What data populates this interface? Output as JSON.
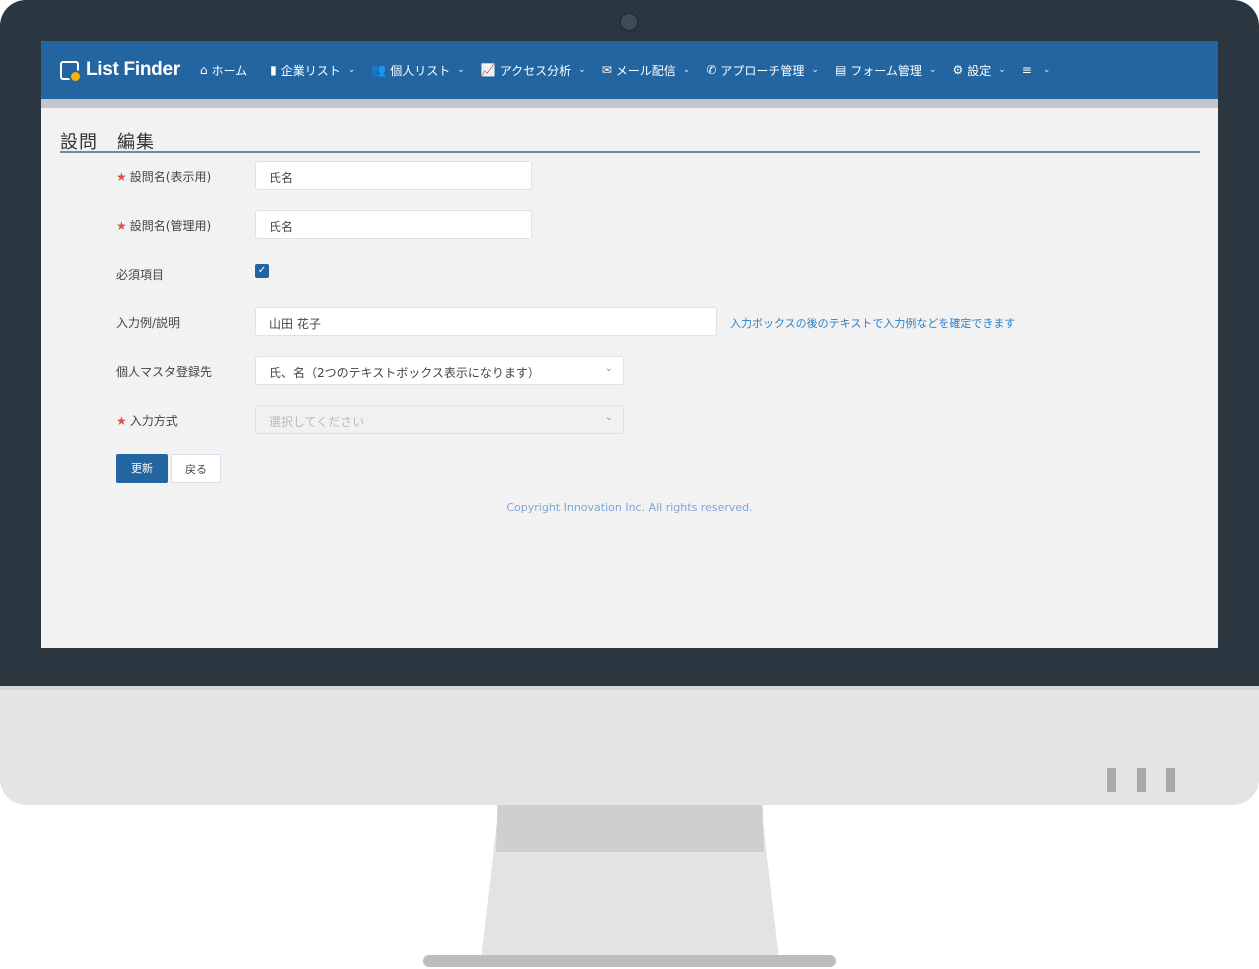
{
  "app": {
    "brand": "List Finder"
  },
  "nav": {
    "items": [
      {
        "icon": "home-icon",
        "glyph": "⌂",
        "label": "ホーム",
        "chevron": ""
      },
      {
        "icon": "building-icon",
        "glyph": "▮",
        "label": "企業リスト",
        "chevron": "⌄"
      },
      {
        "icon": "users-icon",
        "glyph": "👥",
        "label": "個人リスト",
        "chevron": "⌄"
      },
      {
        "icon": "chart-icon",
        "glyph": "📈",
        "label": "アクセス分析",
        "chevron": "⌄"
      },
      {
        "icon": "envelope-icon",
        "glyph": "✉",
        "label": "メール配信",
        "chevron": "⌄"
      },
      {
        "icon": "phone-icon",
        "glyph": "✆",
        "label": "アプローチ管理",
        "chevron": "⌄"
      },
      {
        "icon": "form-icon",
        "glyph": "▤",
        "label": "フォーム管理",
        "chevron": "⌄"
      },
      {
        "icon": "gear-icon",
        "glyph": "⚙",
        "label": "設定",
        "chevron": "⌄"
      },
      {
        "icon": "menu-icon",
        "glyph": "≡",
        "label": "",
        "chevron": "⌄"
      }
    ]
  },
  "page": {
    "title": "設問　編集"
  },
  "form": {
    "required_mark": "★",
    "display_name": {
      "label": "設問名(表示用)",
      "value": "氏名"
    },
    "admin_name": {
      "label": "設問名(管理用)",
      "value": "氏名"
    },
    "required": {
      "label": "必須項目",
      "checked_glyph": "✓"
    },
    "example": {
      "label": "入力例/説明",
      "value": "山田 花子",
      "hint": "入力ボックスの後のテキストで入力例などを確定できます"
    },
    "master": {
      "label": "個人マスタ登録先",
      "value": "氏、名（2つのテキストボックス表示になります）",
      "arrow": "⌄"
    },
    "input_type": {
      "label": "入力方式",
      "placeholder": "選択してください",
      "arrow": "⌄"
    }
  },
  "buttons": {
    "update": "更新",
    "back": "戻る"
  },
  "footer": {
    "copyright": "Copyright Innovation Inc. All rights reserved."
  }
}
